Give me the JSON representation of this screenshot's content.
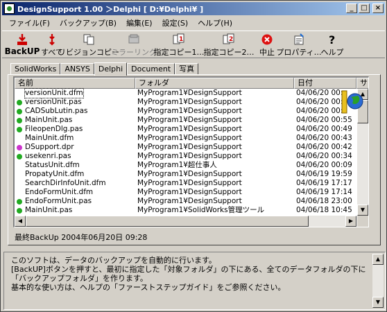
{
  "window": {
    "title": "DesignSupport 1.00 ＞Delphi [ D:¥Delphi¥ ]",
    "buttons": {
      "minimize": "_",
      "maximize": "□",
      "close": "×"
    }
  },
  "menu": [
    {
      "label": "ファイル(F)"
    },
    {
      "label": "バックアップ(B)"
    },
    {
      "label": "編集(E)"
    },
    {
      "label": "設定(S)"
    },
    {
      "label": "ヘルプ(H)"
    }
  ],
  "toolbar": {
    "backup": "BackUP",
    "all": "すべて",
    "revision_copy": "リビジョンコピー",
    "mirroring": "ミラーリング",
    "copy1": "指定コピー1…",
    "copy2": "指定コピー2…",
    "stop": "中止",
    "properties": "プロパティ…",
    "help": "ヘルプ"
  },
  "tabs": [
    {
      "label": "SolidWorks"
    },
    {
      "label": "ANSYS"
    },
    {
      "label": "Delphi"
    },
    {
      "label": "Document"
    },
    {
      "label": "写真"
    }
  ],
  "active_tab": "Delphi",
  "list": {
    "columns": [
      "名前",
      "フォルダ",
      "日付",
      "サイ"
    ],
    "rows": [
      {
        "name": "versionUnit.dfm",
        "folder": "MyProgram1¥DesignSupport",
        "date": "04/06/20 00:",
        "dot": ""
      },
      {
        "name": "versionUnit.pas",
        "folder": "MyProgram1¥DesignSupport",
        "date": "04/06/20 00:",
        "dot": "#22aa22"
      },
      {
        "name": "CADSubLutin.pas",
        "folder": "MyProgram1¥DesignSupport",
        "date": "04/06/20 00:",
        "dot": "#22aa22"
      },
      {
        "name": "MainUnit.pas",
        "folder": "MyProgram1¥DesignSupport",
        "date": "04/06/20 00:55",
        "dot": "#22aa22"
      },
      {
        "name": "FileopenDlg.pas",
        "folder": "MyProgram1¥DesignSupport",
        "date": "04/06/20 00:49",
        "dot": "#22aa22"
      },
      {
        "name": "MainUnit.dfm",
        "folder": "MyProgram1¥DesignSupport",
        "date": "04/06/20 00:43",
        "dot": ""
      },
      {
        "name": "DSupport.dpr",
        "folder": "MyProgram1¥DesignSupport",
        "date": "04/06/20 00:42",
        "dot": "#cc33cc"
      },
      {
        "name": "usekenri.pas",
        "folder": "MyProgram1¥DesignSupport",
        "date": "04/06/20 00:34",
        "dot": "#22aa22"
      },
      {
        "name": "StatusUnit.dfm",
        "folder": "MyProgram1¥超仕事人",
        "date": "04/06/20 00:09",
        "dot": ""
      },
      {
        "name": "PropatyUnit.dfm",
        "folder": "MyProgram1¥DesignSupport",
        "date": "04/06/19 19:59",
        "dot": ""
      },
      {
        "name": "SearchDirInfoUnit.dfm",
        "folder": "MyProgram1¥DesignSupport",
        "date": "04/06/19 17:17",
        "dot": ""
      },
      {
        "name": "EndoFormUnit.dfm",
        "folder": "MyProgram1¥DesignSupport",
        "date": "04/06/19 17:14",
        "dot": ""
      },
      {
        "name": "EndoFormUnit.pas",
        "folder": "MyProgram1¥DesignSupport",
        "date": "04/06/18 23:00",
        "dot": "#22aa22"
      },
      {
        "name": "MainUnit.pas",
        "folder": "MyProgram1¥SolidWorks管理ツール",
        "date": "04/06/18 10:45",
        "dot": "#22aa22"
      }
    ]
  },
  "status": {
    "last_backup": "最終BackUp 2004年06月20日 09:28"
  },
  "info": {
    "lines": [
      "このソフトは、データのバックアップを自動的に行います。",
      "[BackUP]ボタンを押すと、最初に指定した「対象フォルダ」の下にある、全てのデータフォルダの下に",
      "「バックアップフォルダ」を作ります。",
      "基本的な使い方は、ヘルプの「ファーストステップガイド」をご参照ください。"
    ]
  },
  "colors": {
    "titlebar_start": "#0a246a",
    "titlebar_end": "#a6caf0",
    "face": "#d4d0c8",
    "dot_green": "#22aa22",
    "dot_magenta": "#cc33cc"
  }
}
